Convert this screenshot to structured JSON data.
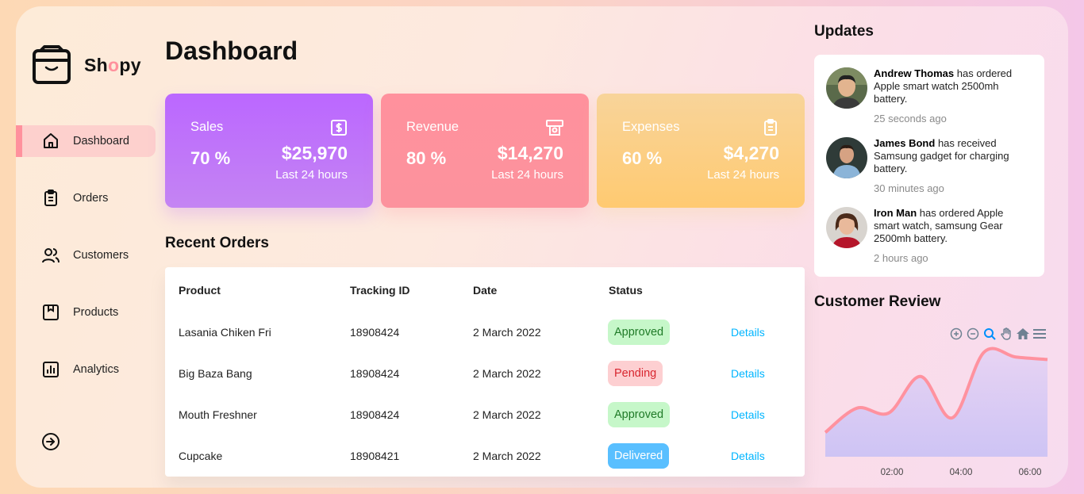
{
  "brand": {
    "name_pre": "Sh",
    "name_o": "o",
    "name_post": "py",
    "accent": "#ff919d"
  },
  "sidebar": {
    "items": [
      {
        "label": "Dashboard",
        "icon": "home-icon",
        "active": true
      },
      {
        "label": "Orders",
        "icon": "clipboard-icon",
        "active": false
      },
      {
        "label": "Customers",
        "icon": "users-icon",
        "active": false
      },
      {
        "label": "Products",
        "icon": "package-icon",
        "active": false
      },
      {
        "label": "Analytics",
        "icon": "bar-chart-icon",
        "active": false
      }
    ],
    "logout_icon": "sign-out-icon"
  },
  "page": {
    "title": "Dashboard"
  },
  "cards": [
    {
      "title": "Sales",
      "percent": "70 %",
      "amount": "$25,970",
      "period": "Last 24 hours",
      "icon": "dollar-icon",
      "color": "#bb67ff"
    },
    {
      "title": "Revenue",
      "percent": "80 %",
      "amount": "$14,270",
      "period": "Last 24 hours",
      "icon": "money-icon",
      "color": "#ff919d"
    },
    {
      "title": "Expenses",
      "percent": "60 %",
      "amount": "$4,270",
      "period": "Last 24 hours",
      "icon": "clipboard-icon",
      "color": "#ffca71"
    }
  ],
  "orders": {
    "title": "Recent Orders",
    "columns": [
      "Product",
      "Tracking ID",
      "Date",
      "Status",
      ""
    ],
    "rows": [
      {
        "product": "Lasania Chiken Fri",
        "tracking": "18908424",
        "date": "2 March 2022",
        "status": "Approved",
        "action": "Details"
      },
      {
        "product": "Big Baza Bang",
        "tracking": "18908424",
        "date": "2 March 2022",
        "status": "Pending",
        "action": "Details"
      },
      {
        "product": "Mouth Freshner",
        "tracking": "18908424",
        "date": "2 March 2022",
        "status": "Approved",
        "action": "Details"
      },
      {
        "product": "Cupcake",
        "tracking": "18908421",
        "date": "2 March 2022",
        "status": "Delivered",
        "action": "Details"
      }
    ]
  },
  "updates": {
    "title": "Updates",
    "items": [
      {
        "name": "Andrew Thomas",
        "text": "has ordered Apple smart watch 2500mh battery.",
        "time": "25 seconds ago"
      },
      {
        "name": "James Bond",
        "text": "has received Samsung gadget for charging battery.",
        "time": "30 minutes ago"
      },
      {
        "name": "Iron Man",
        "text": "has ordered Apple smart watch, samsung Gear 2500mh battery.",
        "time": "2 hours ago"
      }
    ]
  },
  "review": {
    "title": "Customer Review",
    "toolbar_icons": [
      "zoom-in-icon",
      "zoom-out-icon",
      "magnifier-icon",
      "pan-hand-icon",
      "home-reset-icon",
      "menu-icon"
    ],
    "x_ticks": [
      "02:00",
      "04:00",
      "06:00"
    ]
  },
  "chart_data": {
    "type": "area",
    "x": [
      0,
      1,
      2,
      3,
      4,
      5,
      6,
      7
    ],
    "values": [
      1,
      2,
      1.8,
      3.3,
      1.6,
      4.3,
      4.1,
      4.0
    ],
    "x_tick_labels": [
      "02:00",
      "04:00",
      "06:00"
    ],
    "stroke": "#ff929f",
    "fill": "#d9c8f5",
    "grid": false
  }
}
